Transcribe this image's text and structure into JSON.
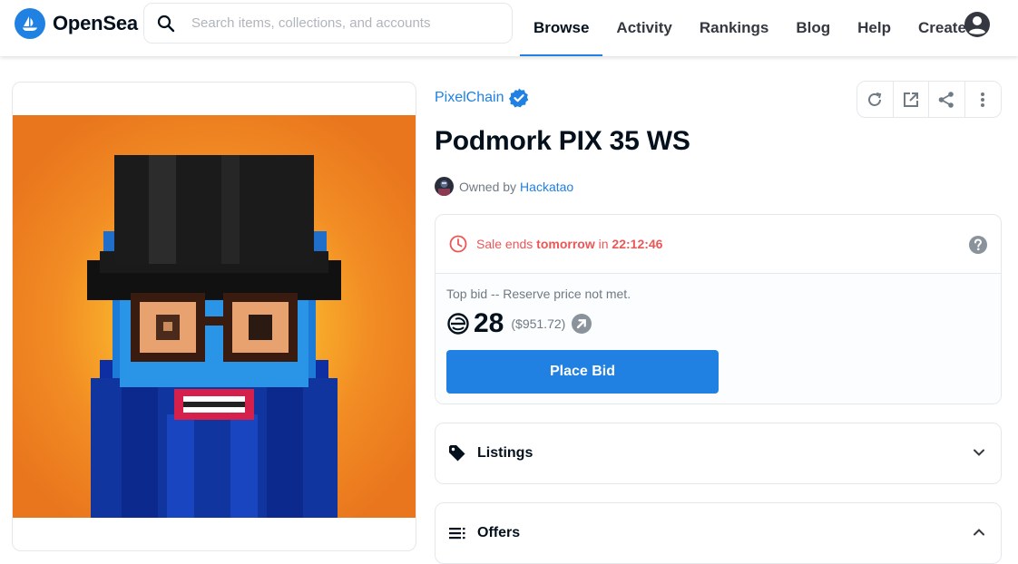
{
  "nav": {
    "brand": "OpenSea",
    "search_placeholder": "Search items, collections, and accounts",
    "items": [
      {
        "label": "Browse",
        "active": true
      },
      {
        "label": "Activity"
      },
      {
        "label": "Rankings"
      },
      {
        "label": "Blog"
      },
      {
        "label": "Help"
      },
      {
        "label": "Create"
      }
    ],
    "account_icon": "account-circle-icon"
  },
  "asset": {
    "collection": "PixelChain",
    "name": "Podmork PIX 35 WS",
    "owned_by_label": "Owned by",
    "owner": "Hackatao"
  },
  "sale": {
    "ends_prefix": "Sale ends ",
    "ends_day": "tomorrow",
    "ends_mid": " in ",
    "ends_time": "22:12:46",
    "top_bid_label": "Top bid -- Reserve price not met.",
    "amount": "28",
    "usd": "($951.72)",
    "place_bid_label": "Place Bid"
  },
  "panels": {
    "listings": "Listings",
    "offers": "Offers"
  },
  "colors": {
    "accent": "#2081e2",
    "alert": "#eb5757",
    "text": "#04111d",
    "muted": "#707a83",
    "border": "#e5e8eb"
  }
}
